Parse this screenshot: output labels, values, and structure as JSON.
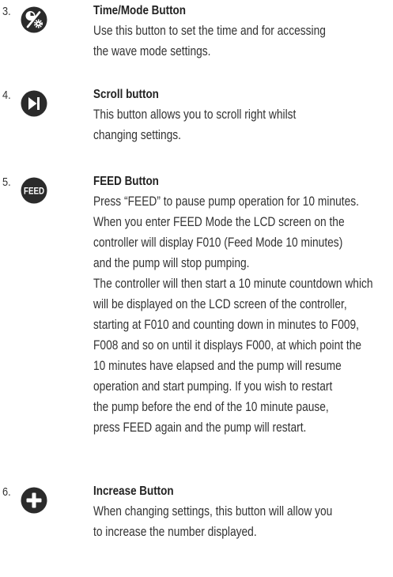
{
  "items": [
    {
      "number": "3.",
      "icon": "time-mode-icon",
      "title": "Time/Mode Button",
      "lines": [
        "Use this button to set the time and for accessing",
        "the wave mode settings."
      ]
    },
    {
      "number": "4.",
      "icon": "scroll-right-icon",
      "title": "Scroll button",
      "lines": [
        "This button allows you to scroll right whilst",
        "changing settings."
      ]
    },
    {
      "number": "5.",
      "icon": "feed-icon",
      "icon_text": "FEED",
      "title": "FEED Button",
      "lines": [
        "Press “FEED” to pause pump operation for 10 minutes.",
        "When you enter FEED Mode the LCD screen on the",
        "controller will display F010 (Feed Mode 10 minutes)",
        "and the pump will stop pumping.",
        "The controller will then start a 10 minute countdown which",
        "will be displayed on the LCD screen of the controller,",
        "starting at F010 and counting down in minutes to F009,",
        "F008 and so on until it displays F000, at which point the",
        "10 minutes have elapsed and the pump will resume",
        "operation and start pumping. If you wish to restart",
        "the pump before the end of the 10 minute pause,",
        "press FEED again and the pump will restart."
      ]
    },
    {
      "number": "6.",
      "icon": "plus-icon",
      "title": "Increase Button",
      "lines": [
        "When changing settings, this button will allow you",
        "to increase the number displayed."
      ]
    }
  ],
  "colors": {
    "icon": "#2b2b2b",
    "text": "#333333"
  }
}
